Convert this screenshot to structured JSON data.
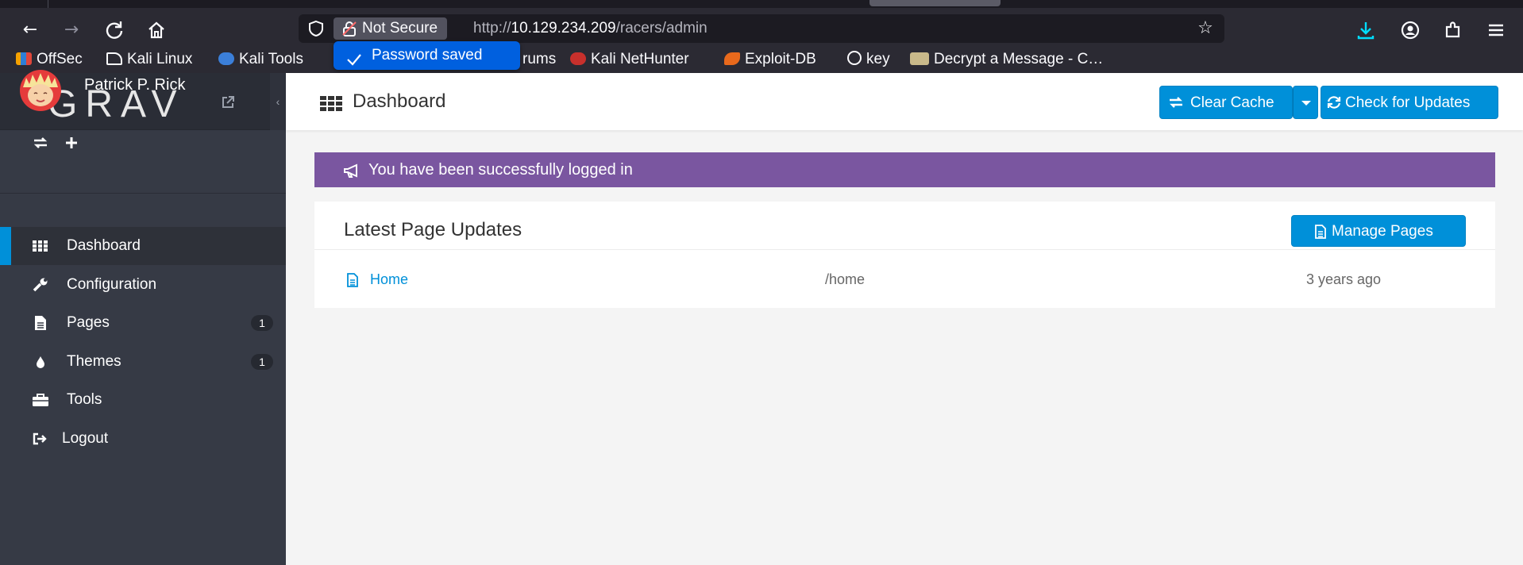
{
  "browser": {
    "not_secure_label": "Not Secure",
    "url_prefix": "http://",
    "url_host": "10.129.234.209",
    "url_path": "/racers/admin",
    "password_saved": "Password saved",
    "accent_color": "#0060df",
    "bookmarks": [
      {
        "label": "OffSec",
        "icon": "offsec-icon"
      },
      {
        "label": "Kali Linux",
        "icon": "kali-icon"
      },
      {
        "label": "Kali Tools",
        "icon": "kali-tools-icon"
      },
      {
        "label": "rums",
        "icon": ""
      },
      {
        "label": "Kali NetHunter",
        "icon": "nethunter-icon"
      },
      {
        "label": "Exploit-DB",
        "icon": "exploitdb-icon"
      },
      {
        "label": "key",
        "icon": "globe-icon"
      },
      {
        "label": "Decrypt a Message - C…",
        "icon": "decrypt-icon"
      }
    ]
  },
  "sidebar": {
    "logo": "GRAV",
    "user_name": "Patrick P. Rick",
    "items": [
      {
        "label": "Dashboard",
        "icon": "dashboard-grid-icon",
        "active": true
      },
      {
        "label": "Configuration",
        "icon": "wrench-icon"
      },
      {
        "label": "Pages",
        "icon": "file-icon",
        "badge": "1"
      },
      {
        "label": "Themes",
        "icon": "droplet-icon",
        "badge": "1"
      },
      {
        "label": "Tools",
        "icon": "briefcase-icon"
      },
      {
        "label": "Logout",
        "icon": "sign-out-icon"
      }
    ],
    "accent_color": "#0090d9"
  },
  "header": {
    "title": "Dashboard",
    "clear_cache": "Clear Cache",
    "check_updates": "Check for Updates"
  },
  "alert": {
    "message": "You have been successfully logged in",
    "color": "#7a56a0"
  },
  "latest": {
    "title": "Latest Page Updates",
    "manage_button": "Manage Pages",
    "rows": [
      {
        "title": "Home",
        "route": "/home",
        "updated": "3 years ago"
      }
    ]
  }
}
